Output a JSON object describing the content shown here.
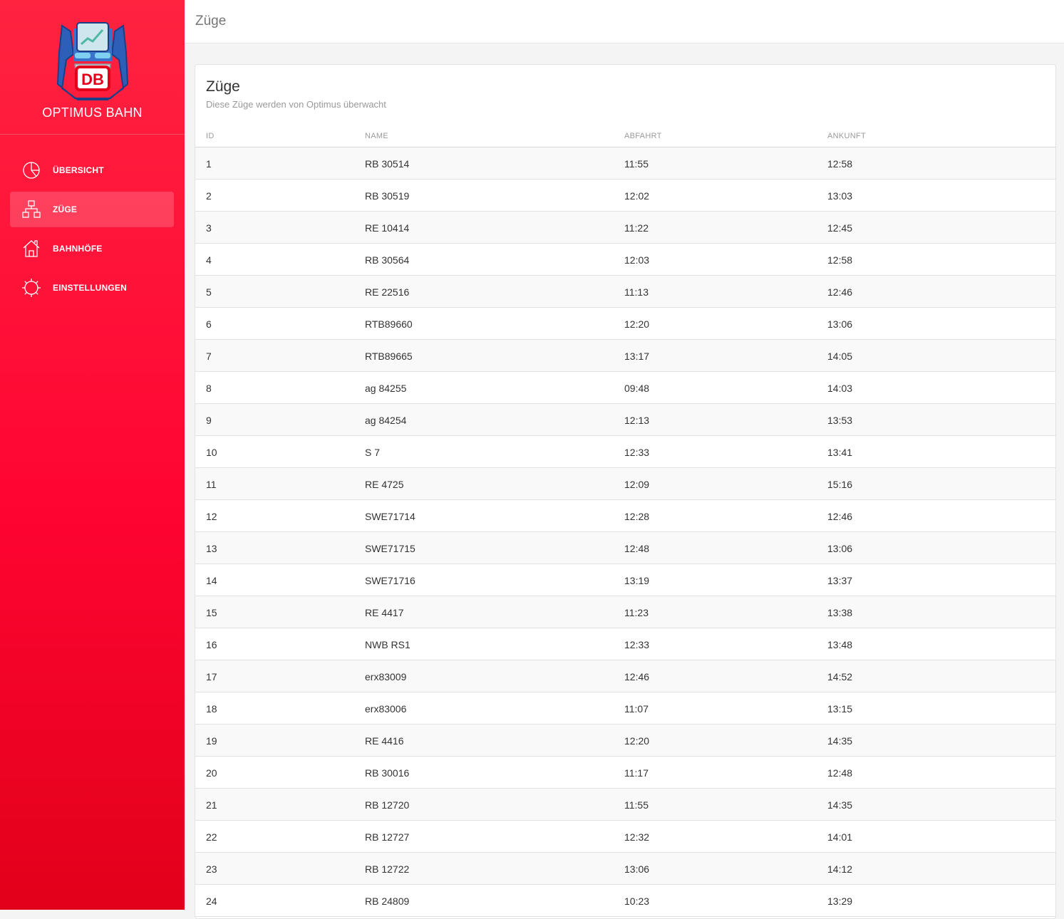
{
  "brand": {
    "name": "OPTIMUS BAHN",
    "logo_text": "DB",
    "logo_icon": "optimus-db-logo"
  },
  "nav": {
    "items": [
      {
        "label": "ÜBERSICHT",
        "icon": "pie-chart-icon",
        "active": false
      },
      {
        "label": "ZÜGE",
        "icon": "hierarchy-icon",
        "active": true
      },
      {
        "label": "BAHNHÖFE",
        "icon": "house-icon",
        "active": false
      },
      {
        "label": "EINSTELLUNGEN",
        "icon": "gear-icon",
        "active": false
      }
    ]
  },
  "topbar": {
    "title": "Züge"
  },
  "card": {
    "title": "Züge",
    "subtitle": "Diese Züge werden von Optimus überwacht",
    "columns": {
      "id": "ID",
      "name": "NAME",
      "departure": "ABFAHRT",
      "arrival": "ANKUNFT"
    },
    "rows": [
      {
        "id": "1",
        "name": "RB 30514",
        "departure": "11:55",
        "arrival": "12:58"
      },
      {
        "id": "2",
        "name": "RB 30519",
        "departure": "12:02",
        "arrival": "13:03"
      },
      {
        "id": "3",
        "name": "RE 10414",
        "departure": "11:22",
        "arrival": "12:45"
      },
      {
        "id": "4",
        "name": "RB 30564",
        "departure": "12:03",
        "arrival": "12:58"
      },
      {
        "id": "5",
        "name": "RE 22516",
        "departure": "11:13",
        "arrival": "12:46"
      },
      {
        "id": "6",
        "name": "RTB89660",
        "departure": "12:20",
        "arrival": "13:06"
      },
      {
        "id": "7",
        "name": "RTB89665",
        "departure": "13:17",
        "arrival": "14:05"
      },
      {
        "id": "8",
        "name": "ag 84255",
        "departure": "09:48",
        "arrival": "14:03"
      },
      {
        "id": "9",
        "name": "ag 84254",
        "departure": "12:13",
        "arrival": "13:53"
      },
      {
        "id": "10",
        "name": "S 7",
        "departure": "12:33",
        "arrival": "13:41"
      },
      {
        "id": "11",
        "name": "RE 4725",
        "departure": "12:09",
        "arrival": "15:16"
      },
      {
        "id": "12",
        "name": "SWE71714",
        "departure": "12:28",
        "arrival": "12:46"
      },
      {
        "id": "13",
        "name": "SWE71715",
        "departure": "12:48",
        "arrival": "13:06"
      },
      {
        "id": "14",
        "name": "SWE71716",
        "departure": "13:19",
        "arrival": "13:37"
      },
      {
        "id": "15",
        "name": "RE 4417",
        "departure": "11:23",
        "arrival": "13:38"
      },
      {
        "id": "16",
        "name": "NWB RS1",
        "departure": "12:33",
        "arrival": "13:48"
      },
      {
        "id": "17",
        "name": "erx83009",
        "departure": "12:46",
        "arrival": "14:52"
      },
      {
        "id": "18",
        "name": "erx83006",
        "departure": "11:07",
        "arrival": "13:15"
      },
      {
        "id": "19",
        "name": "RE 4416",
        "departure": "12:20",
        "arrival": "14:35"
      },
      {
        "id": "20",
        "name": "RB 30016",
        "departure": "11:17",
        "arrival": "12:48"
      },
      {
        "id": "21",
        "name": "RB 12720",
        "departure": "11:55",
        "arrival": "14:35"
      },
      {
        "id": "22",
        "name": "RB 12727",
        "departure": "12:32",
        "arrival": "14:01"
      },
      {
        "id": "23",
        "name": "RB 12722",
        "departure": "13:06",
        "arrival": "14:12"
      },
      {
        "id": "24",
        "name": "RB 24809",
        "departure": "10:23",
        "arrival": "13:29"
      }
    ]
  },
  "colors": {
    "sidebar_top": "#ff2340",
    "sidebar_bottom": "#e2001a",
    "accent": "#e2001a"
  }
}
